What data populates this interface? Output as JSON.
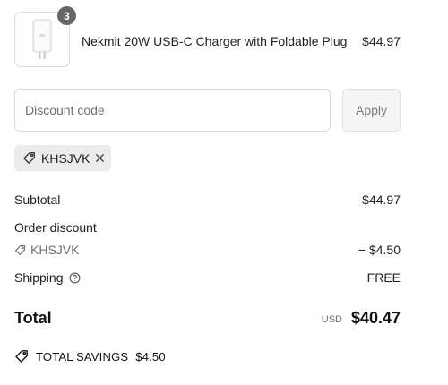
{
  "line_item": {
    "image_alt": "Nekmit 20W USB-C Charger with Foldable Plug",
    "quantity": "3",
    "name": "Nekmit 20W USB-C Charger with Foldable Plug",
    "price": "$44.97"
  },
  "discount": {
    "placeholder": "Discount code",
    "value": "",
    "apply_label": "Apply",
    "applied_code": "KHSJVK"
  },
  "summary": {
    "subtotal_label": "Subtotal",
    "subtotal_value": "$44.97",
    "order_discount_label": "Order discount",
    "discount_code": "KHSJVK",
    "discount_value": "− $4.50",
    "shipping_label": "Shipping",
    "shipping_value": "FREE",
    "total_label": "Total",
    "total_currency": "USD",
    "total_value": "$40.47",
    "savings_label": "TOTAL SAVINGS",
    "savings_value": "$4.50"
  },
  "icons": {
    "tag": "tag-icon",
    "close": "close-icon",
    "help": "help-circle-icon",
    "savings": "savings-tag-icon"
  },
  "colors": {
    "badge": "#666666",
    "chip_bg": "#ececec",
    "muted_text": "#707070",
    "button_bg": "#f5f5f5"
  }
}
